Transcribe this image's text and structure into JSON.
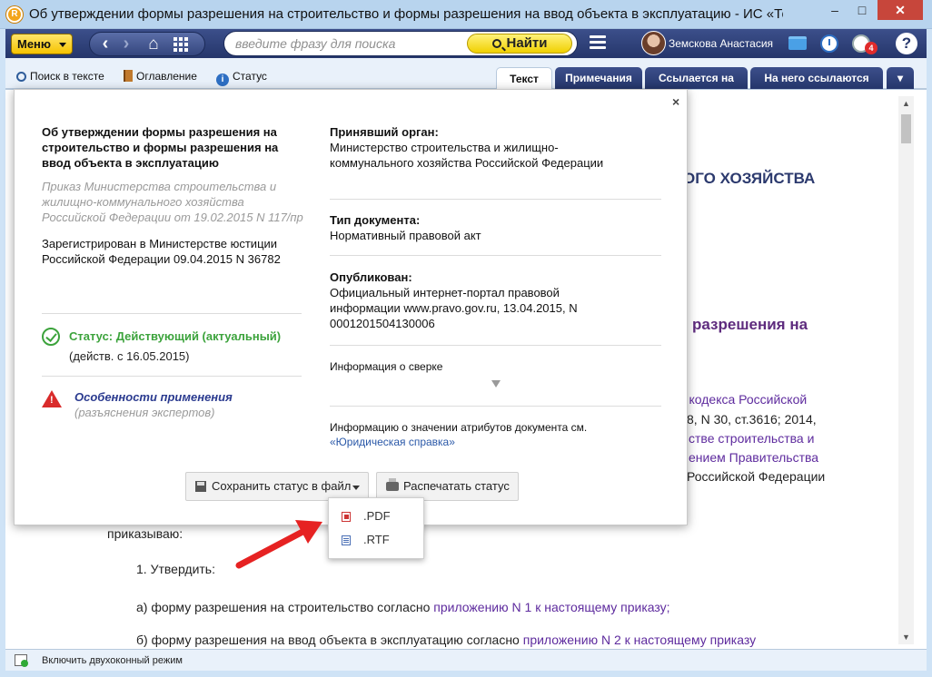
{
  "window": {
    "title": "Об утверждении формы разрешения на строительство и формы разрешения на ввод объекта в эксплуатацию - ИС «Техэксп",
    "app_icon_letter": "R",
    "minimize": "–",
    "maximize": "□",
    "close": "✕"
  },
  "toolbar": {
    "menu_label": "Меню",
    "search_placeholder": "введите фразу для поиска",
    "search_button": "Найти",
    "user_name": "Земскова Анастасия",
    "notifications_count": "4",
    "help": "?",
    "nav_back": "‹",
    "nav_forward": "›",
    "home": "⌂"
  },
  "subbar": {
    "links": [
      "Поиск в тексте",
      "Оглавление",
      "Статус"
    ],
    "tabs": [
      "Текст",
      "Примечания",
      "Ссылается на",
      "На него ссылаются"
    ],
    "tabs_more": "▾",
    "info_glyph": "i"
  },
  "document": {
    "heading_right": "ОГО ХОЗЯЙСТВА",
    "heading_purple": "разрешения на",
    "para_lines": [
      "го кодекса Российской",
      "8, N 30, ст.3616; 2014,",
      "стве строительства и",
      "ением Правительства",
      "Российской Федерации"
    ],
    "prikazyvayu": "приказываю:",
    "item1": "1. Утвердить:",
    "item_a_prefix": "а) форму разрешения на строительство согласно ",
    "item_a_link": "приложению N 1 к настоящему приказу;",
    "item_b_prefix": "б) форму разрешения на ввод объекта в эксплуатацию согласно ",
    "item_b_link": "приложению N 2 к настоящему приказу"
  },
  "scrollbar": {
    "up": "▲",
    "down": "▼"
  },
  "statusbar": {
    "text": "Включить двухоконный режим"
  },
  "popup": {
    "close": "×",
    "title": "Об утверждении формы разрешения на строительство и формы разрешения на ввод объекта в эксплуатацию",
    "subtitle": "Приказ Министерства строительства и жилищно-коммунального хозяйства Российской Федерации от 19.02.2015 N 117/пр",
    "registered": "Зарегистрирован в Министерстве юстиции Российской Федерации 09.04.2015 N 36782",
    "status_label": "Статус: Действующий (актуальный)",
    "status_date": "(действ. с 16.05.2015)",
    "features_label": "Особенности применения",
    "features_sub": "(разъяснения экспертов)",
    "issuer_label": "Принявший орган:",
    "issuer_value": "Министерство строительства и жилищно-коммунального хозяйства Российской Федерации",
    "doctype_label": "Тип документа:",
    "doctype_value": "Нормативный правовой акт",
    "published_label": "Опубликован:",
    "published_value": "Официальный интернет-портал правовой информации www.pravo.gov.ru, 13.04.2015, N 0001201504130006",
    "reconciliation": "Информация о сверке",
    "attributes_info": "Информацию о значении атрибутов документа см.",
    "legal_ref_link": "«Юридическая справка»",
    "save_button": "Сохранить статус в файл",
    "print_button": "Распечатать статус"
  },
  "dropdown": {
    "items": [
      ".PDF",
      ".RTF"
    ]
  },
  "colors": {
    "toolbar_dark": "#25366b",
    "accent_yellow": "#f6c300",
    "status_green": "#3ca33c",
    "warning_red": "#d92b2b",
    "link_purple": "#5e2b9e",
    "annotation_arrow": "#e62222"
  },
  "icons": [
    "app-icon",
    "menu-caret",
    "back-arrow-icon",
    "forward-arrow-icon",
    "home-icon",
    "grid-icon",
    "search-icon",
    "hamburger-icon",
    "avatar",
    "folder-icon",
    "clock-icon",
    "timer-icon",
    "help-icon",
    "book-icon",
    "info-icon",
    "check-icon",
    "warning-icon",
    "save-icon",
    "printer-icon",
    "pdf-icon",
    "rtf-icon"
  ]
}
